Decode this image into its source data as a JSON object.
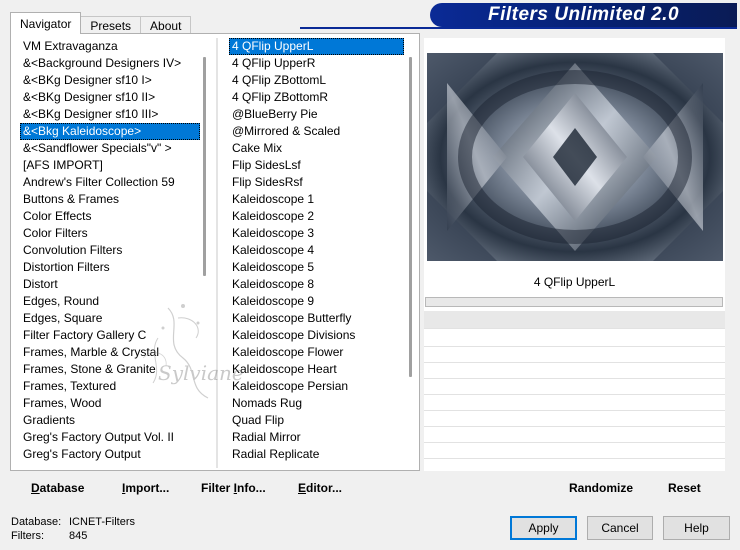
{
  "tabs": [
    "Navigator",
    "Presets",
    "About"
  ],
  "banner_title": "Filters Unlimited 2.0",
  "categories": {
    "selected_index": 5,
    "items": [
      "VM Extravaganza",
      "&<Background Designers IV>",
      "&<BKg Designer sf10 I>",
      "&<BKg Designer sf10 II>",
      "&<BKg Designer sf10 III>",
      "&<Bkg Kaleidoscope>",
      "&<Sandflower Specials\"v\" >",
      "[AFS IMPORT]",
      "Andrew's Filter Collection 59",
      "Buttons & Frames",
      "Color Effects",
      "Color Filters",
      "Convolution Filters",
      "Distortion Filters",
      "Distort",
      "Edges, Round",
      "Edges, Square",
      "Filter Factory Gallery C",
      "Frames, Marble & Crystal",
      "Frames, Stone & Granite",
      "Frames, Textured",
      "Frames, Wood",
      "Gradients",
      "Greg's Factory Output Vol. II",
      "Greg's Factory Output"
    ]
  },
  "filters": {
    "selected_index": 0,
    "items": [
      "4 QFlip UpperL",
      "4 QFlip UpperR",
      "4 QFlip ZBottomL",
      "4 QFlip ZBottomR",
      "@BlueBerry Pie",
      "@Mirrored & Scaled",
      "Cake Mix",
      "Flip SidesLsf",
      "Flip SidesRsf",
      "Kaleidoscope 1",
      "Kaleidoscope 2",
      "Kaleidoscope 3",
      "Kaleidoscope 4",
      "Kaleidoscope 5",
      "Kaleidoscope 8",
      "Kaleidoscope 9",
      "Kaleidoscope Butterfly",
      "Kaleidoscope Divisions",
      "Kaleidoscope Flower",
      "Kaleidoscope Heart",
      "Kaleidoscope Persian",
      "Nomads Rug",
      "Quad Flip",
      "Radial Mirror",
      "Radial Replicate"
    ]
  },
  "preview_filter_name": "4 QFlip UpperL",
  "watermark_text": "Sylviane",
  "bottom_links": {
    "database": {
      "pre": "",
      "u": "D",
      "post": "atabase"
    },
    "import": {
      "pre": "",
      "u": "I",
      "post": "mport..."
    },
    "filter_info": {
      "pre": "Filter ",
      "u": "I",
      "post": "nfo..."
    },
    "editor": {
      "pre": "",
      "u": "E",
      "post": "ditor..."
    }
  },
  "randomize_label": "Randomize",
  "reset_label": "Reset",
  "status": {
    "database_label": "Database:",
    "database_value": "ICNET-Filters",
    "filters_label": "Filters:",
    "filters_value": "845"
  },
  "buttons": {
    "apply": "Apply",
    "cancel": "Cancel",
    "help": "Help"
  },
  "colors": {
    "banner": "#0a2a96",
    "selection": "#0078d7"
  }
}
